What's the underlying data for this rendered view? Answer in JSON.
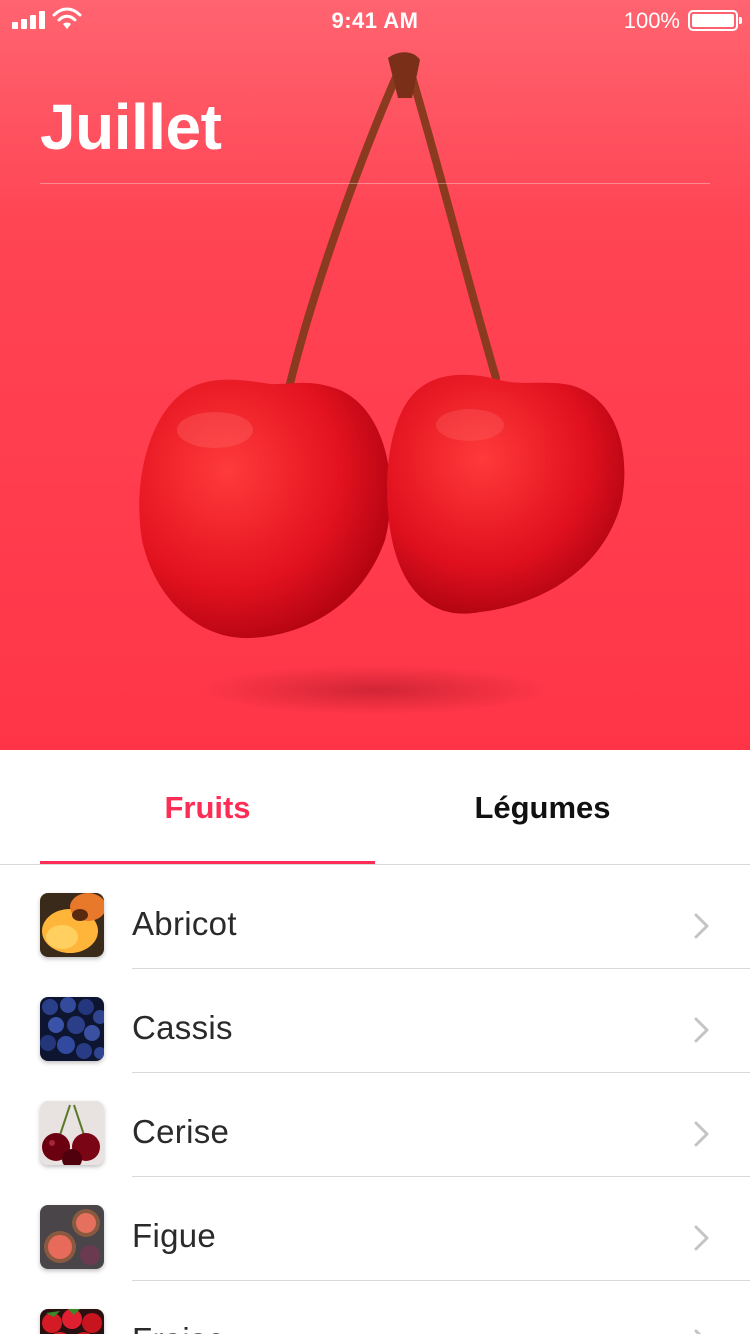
{
  "status_bar": {
    "time": "9:41 AM",
    "battery_percent": "100%",
    "battery_level": 1.0,
    "signal_icon": "cellular-signal-icon",
    "wifi_icon": "wifi-icon",
    "battery_icon": "battery-icon"
  },
  "hero": {
    "title": "Juillet",
    "image": "cherries-image",
    "background_color": "#ff3547"
  },
  "tabs": [
    {
      "label": "Fruits",
      "selected": true
    },
    {
      "label": "Légumes",
      "selected": false
    }
  ],
  "accent_color": "#ff2d55",
  "list": {
    "items": [
      {
        "label": "Abricot",
        "thumbnail": "apricot-thumbnail"
      },
      {
        "label": "Cassis",
        "thumbnail": "blackcurrant-thumbnail"
      },
      {
        "label": "Cerise",
        "thumbnail": "cherry-thumbnail"
      },
      {
        "label": "Figue",
        "thumbnail": "fig-thumbnail"
      },
      {
        "label": "Fraise",
        "thumbnail": "strawberry-thumbnail"
      }
    ],
    "chevron_icon": "chevron-right-icon"
  }
}
